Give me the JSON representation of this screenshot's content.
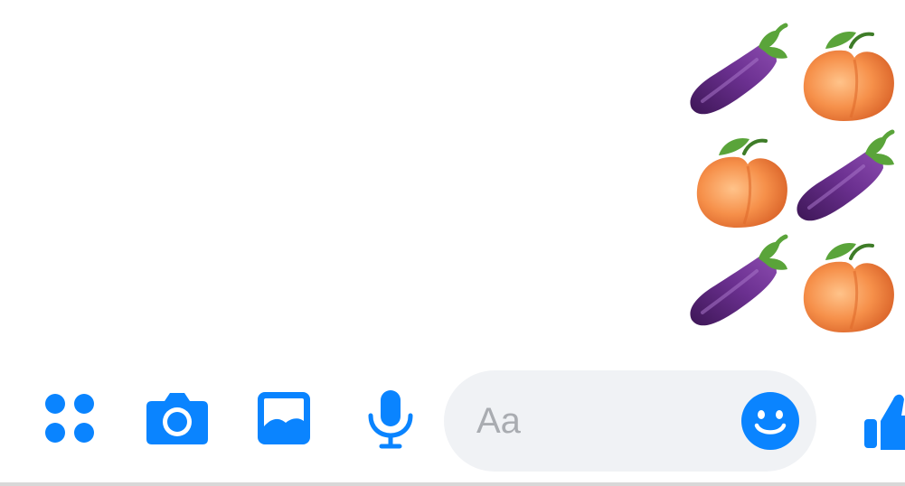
{
  "message": {
    "emojis": [
      "eggplant",
      "peach",
      "peach",
      "eggplant",
      "eggplant",
      "peach"
    ]
  },
  "composer": {
    "more_icon": "four-dots-icon",
    "camera_icon": "camera-icon",
    "gallery_icon": "image-icon",
    "mic_icon": "microphone-icon",
    "placeholder": "Aa",
    "emoji_icon": "smiley-icon",
    "like_icon": "thumbs-up-icon"
  },
  "colors": {
    "accent": "#0a84ff",
    "field_background": "#f0f2f5",
    "placeholder_text": "#a9acb1",
    "eggplant": "#5b2a7a",
    "peach": "#f4904a"
  }
}
